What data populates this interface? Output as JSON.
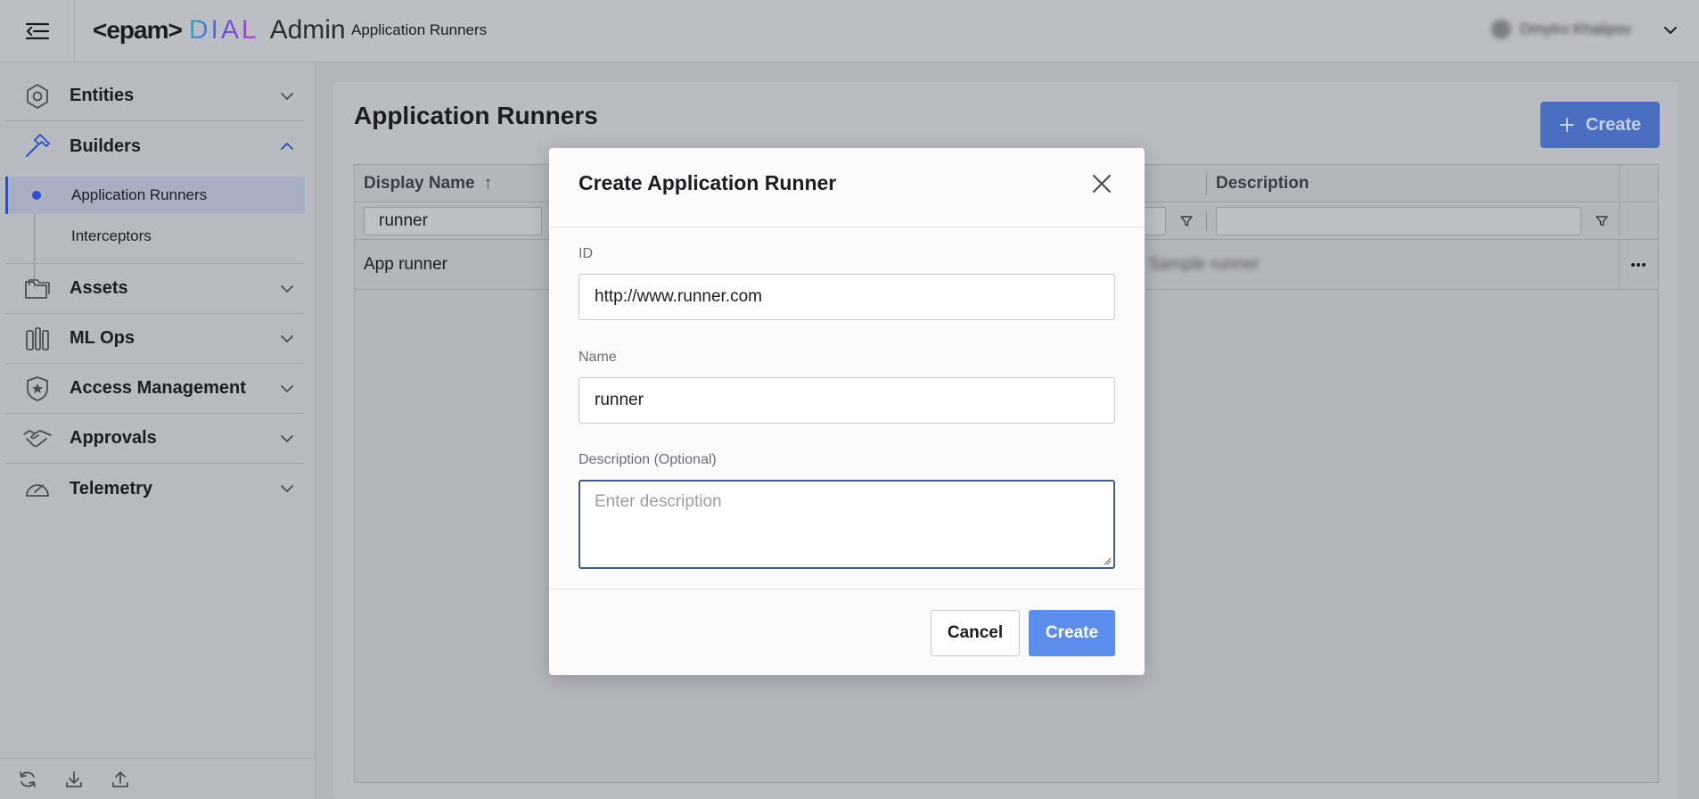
{
  "header": {
    "logo_epam": "<epam>",
    "logo_dial": "DIAL",
    "logo_admin": "Admin",
    "breadcrumb": "Application Runners",
    "user_name": "Dmytro Khalipov"
  },
  "sidebar": {
    "groups": [
      {
        "label": "Entities",
        "icon": "hexagon-icon",
        "expanded": false
      },
      {
        "label": "Builders",
        "icon": "hammer-icon",
        "expanded": true
      },
      {
        "label": "Assets",
        "icon": "folder-icon",
        "expanded": false
      },
      {
        "label": "ML Ops",
        "icon": "tools-icon",
        "expanded": false
      },
      {
        "label": "Access Management",
        "icon": "shield-icon",
        "expanded": false
      },
      {
        "label": "Approvals",
        "icon": "handshake-icon",
        "expanded": false
      },
      {
        "label": "Telemetry",
        "icon": "gauge-icon",
        "expanded": false
      }
    ],
    "builders_items": [
      {
        "label": "Application Runners",
        "active": true
      },
      {
        "label": "Interceptors",
        "active": false
      }
    ],
    "footer_icons": [
      "refresh-icon",
      "download-icon",
      "upload-icon"
    ]
  },
  "main": {
    "title": "Application Runners",
    "create_label": "Create",
    "table": {
      "columns": [
        "Display Name",
        "Description"
      ],
      "sort_indicator": "↑",
      "filters": {
        "display_name": "runner",
        "description": ""
      },
      "rows": [
        {
          "display_name": "App runner",
          "description": "Sample runner"
        }
      ]
    }
  },
  "modal": {
    "title": "Create Application Runner",
    "id_label": "ID",
    "id_value": "http://www.runner.com",
    "name_label": "Name",
    "name_value": "runner",
    "description_label": "Description (Optional)",
    "description_placeholder": "Enter description",
    "cancel_label": "Cancel",
    "create_label": "Create"
  },
  "colors": {
    "accent": "#5b8ded",
    "active_indicator": "#2d4fc9",
    "focus_border": "#3d5a9c"
  }
}
